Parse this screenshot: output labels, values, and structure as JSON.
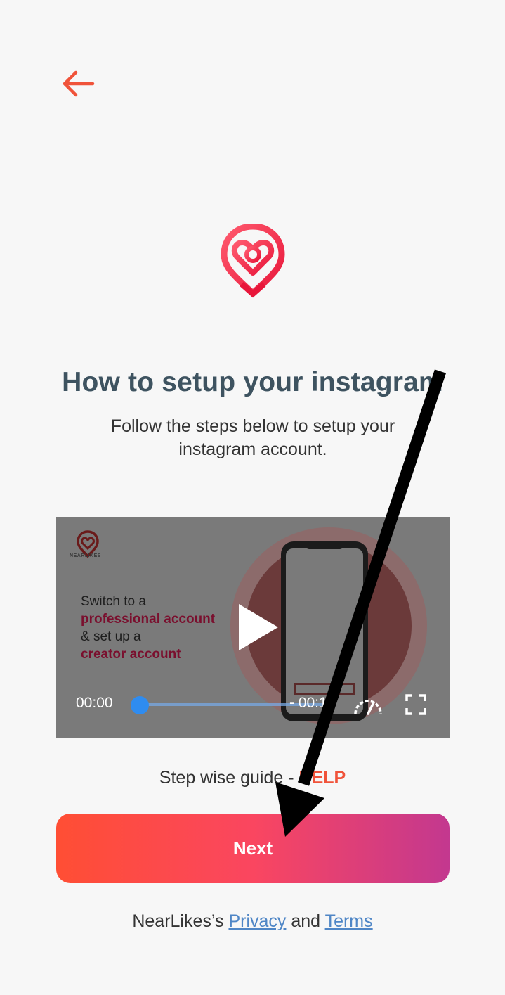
{
  "header": {
    "back_icon": "arrow-left-icon",
    "accent_color": "#f0533a"
  },
  "logo": {
    "icon": "nearlikes-logo-icon",
    "brand_color": "#ef2a45"
  },
  "title": "How to setup your instagram",
  "subtitle": "Follow the steps below to setup your instagram account.",
  "video": {
    "logo_label": "NEARLIKES",
    "line1": "Switch to a",
    "line2": "professional account",
    "line3": "& set up a",
    "line4": "creator account",
    "current_time": "00:00",
    "duration": "- 00:10",
    "progress": 0,
    "play_icon": "play-icon",
    "speed_icon": "playback-speed-icon",
    "fullscreen_icon": "fullscreen-icon"
  },
  "guide": {
    "text": "Step wise guide - ",
    "help_label": "HELP"
  },
  "next_button": {
    "label": "Next"
  },
  "footer": {
    "prefix": "NearLikes’s ",
    "privacy_label": "Privacy",
    "conjunction": " and ",
    "terms_label": "Terms"
  }
}
